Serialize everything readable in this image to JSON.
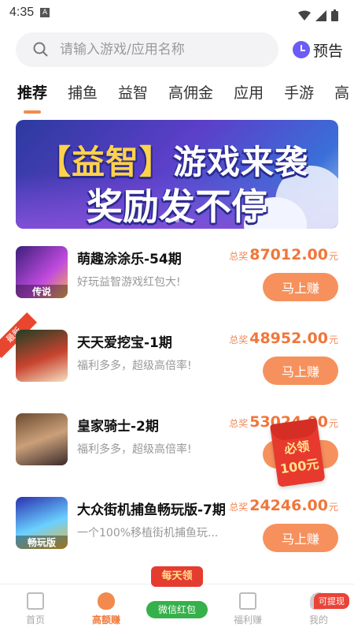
{
  "status": {
    "time": "4:35",
    "a_label": "A"
  },
  "search": {
    "placeholder": "请输入游戏/应用名称",
    "preview_label": "预告"
  },
  "tabs": [
    "推荐",
    "捕鱼",
    "益智",
    "高佣金",
    "应用",
    "手游",
    "高"
  ],
  "banner": {
    "bracket_open": "【",
    "tag": "益智",
    "bracket_close": "】",
    "line1": "游戏来袭",
    "line2": "奖励发不停"
  },
  "games": [
    {
      "name": "萌趣涂涂乐-54期",
      "desc": "好玩益智游戏红包大!",
      "prize_label": "总奖",
      "amount": "87012.00",
      "unit": "元",
      "button": "马上赚",
      "thumb_tag": "传说",
      "new": false
    },
    {
      "name": "天天爱挖宝-1期",
      "desc": "福利多多，超级高倍率!",
      "prize_label": "总奖",
      "amount": "48952.00",
      "unit": "元",
      "button": "马上赚",
      "thumb_tag": "",
      "new": true
    },
    {
      "name": "皇家骑士-2期",
      "desc": "福利多多，超级高倍率!",
      "prize_label": "总奖",
      "amount": "53024.00",
      "unit": "元",
      "button": "马上赚",
      "thumb_tag": "",
      "new": false
    },
    {
      "name": "大众街机捕鱼畅玩版-7期",
      "desc": "一个100%移植街机捕鱼玩...",
      "prize_label": "总奖",
      "amount": "24246.00",
      "unit": "元",
      "button": "马上赚",
      "thumb_tag": "畅玩版",
      "new": false
    }
  ],
  "new_label": "最新",
  "red_packet": {
    "line1": "必领",
    "line2": "100元"
  },
  "bottom_nav": [
    {
      "label": "首页",
      "icon": "home-icon"
    },
    {
      "label": "高额赚",
      "icon": "money-bag-icon"
    },
    {
      "label": "",
      "icon": ""
    },
    {
      "label": "福利赚",
      "icon": "gift-icon"
    },
    {
      "label": "我的",
      "icon": "profile-icon"
    }
  ],
  "wechat": {
    "top": "每天领",
    "pill": "微信红包"
  },
  "withdraw_badge": "可提现",
  "colors": {
    "accent": "#f0763a",
    "button": "#f6915d",
    "red": "#e8392f",
    "green": "#35b04a"
  }
}
